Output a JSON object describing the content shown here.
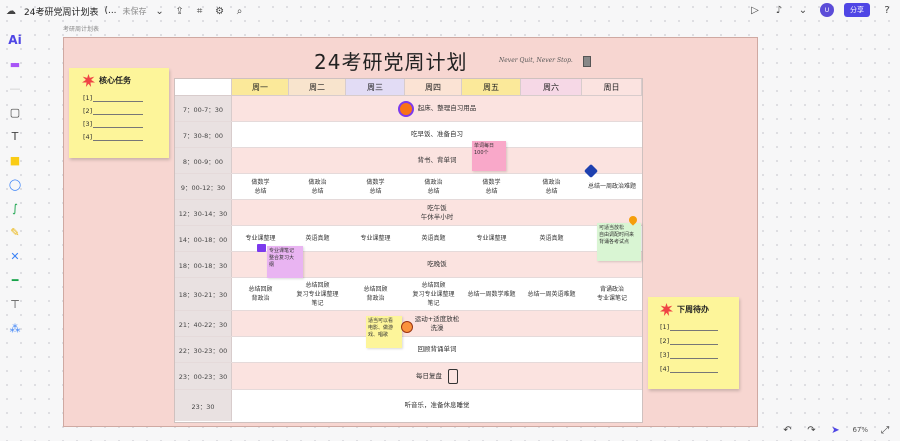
{
  "topbar": {
    "title": "24考研党周计划表",
    "title_suffix": "(...",
    "subtitle": "未保存",
    "share": "分享",
    "avatar": "U"
  },
  "breadcrumb": "考研周计划表",
  "board": {
    "title": "24考研党周计划",
    "subtitle": "Never Quit, Never Stop."
  },
  "table": {
    "days": [
      "周一",
      "周二",
      "周三",
      "周四",
      "周五",
      "周六",
      "周日"
    ],
    "rows": {
      "r1": {
        "time": "7：00-7：30",
        "text": "起床、整理自习用品"
      },
      "r2": {
        "time": "7：30-8：00",
        "text": "吃早饭、准备自习"
      },
      "r3": {
        "time": "8：00-9：00",
        "text": "背书、背单词"
      },
      "r4": {
        "time": "9：00-12：30",
        "cells": [
          "做数学\n总结",
          "做政治\n总结",
          "做数学\n总结",
          "做政治\n总结",
          "做数学\n总结",
          "做政治\n总结",
          "总结一周政治难题"
        ]
      },
      "r5": {
        "time": "12：30-14：30",
        "text": "吃午饭\n午休半小时"
      },
      "r6": {
        "time": "14：00-18：00",
        "cells": [
          "专业课整理",
          "英语真题",
          "专业课整理",
          "英语真题",
          "专业课整理",
          "英语真题",
          ""
        ]
      },
      "r7": {
        "time": "18：00-18：30",
        "text": "吃晚饭"
      },
      "r8": {
        "time": "18：30-21：30",
        "cells": [
          "总结回顾\n背政治",
          "总结回顾\n复习专业课整理\n笔记",
          "总结回顾\n背政治",
          "总结回顾\n复习专业课整理\n笔记",
          "总结一周数学难题",
          "总结一周英语难题",
          "背诵政治\n专业课笔记"
        ]
      },
      "r9": {
        "time": "21：40-22：30",
        "text": "运动+适度放松\n洗澡"
      },
      "r10": {
        "time": "22：30-23：00",
        "text": "回顾背诵单词"
      },
      "r11": {
        "time": "23：00-23：30",
        "text": "每日复盘"
      },
      "r12": {
        "time": "23：30",
        "text": "听音乐，准备休息睡觉"
      }
    }
  },
  "notes": {
    "core": {
      "title": "核心任务",
      "items": [
        "[1]",
        "[2]",
        "[3]",
        "[4]"
      ]
    },
    "next": {
      "title": "下周待办",
      "items": [
        "[1]",
        "[2]",
        "[3]",
        "[4]"
      ]
    },
    "n1": "单词每日\n100个",
    "n2": "专业课笔记\n整合复习大\n纲",
    "n3": "可适当放松\n自由调配时间来\n背诵各考试点",
    "n4": "适当可以看\n电影、做游\n戏、唱歌"
  },
  "bottom": {
    "zoom": "67%"
  }
}
